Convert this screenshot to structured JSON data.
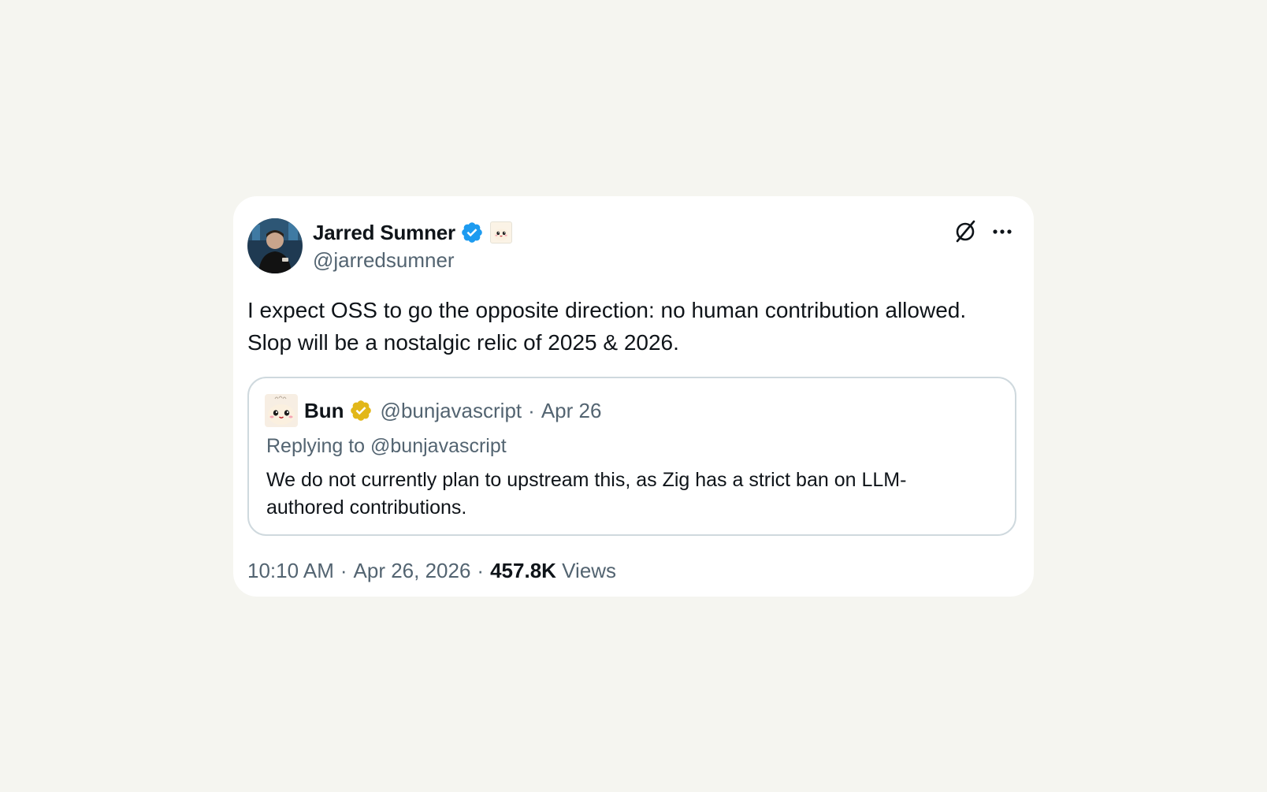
{
  "tweet": {
    "author": {
      "name": "Jarred Sumner",
      "handle": "@jarredsumner",
      "avatar_icon": "person-avatar",
      "verified_icon": "blue-verified-badge",
      "affiliate_icon": "bun-mascot-badge"
    },
    "header_icons": [
      "x-logo-icon",
      "more-options-icon"
    ],
    "text": "I expect OSS to go the opposite direction: no human contribution allowed.\nSlop will be a nostalgic relic of 2025 & 2026.",
    "quote": {
      "name": "Bun",
      "handle": "@bunjavascript",
      "separator": "·",
      "date": "Apr 26",
      "avatar_icon": "bun-mascot-avatar",
      "verified_icon": "gold-verified-badge",
      "replying_to": "Replying to @bunjavascript",
      "text": "We do not currently plan to upstream this, as Zig has a strict ban on LLM-\nauthored contributions."
    },
    "footer": {
      "time": "10:10 AM",
      "separator": "·",
      "date": "Apr 26, 2026",
      "views_count": "457.8K",
      "views_label": "Views"
    }
  },
  "colors": {
    "page_background": "#f5f5f0",
    "card_background": "#ffffff",
    "primary_text": "#0f1419",
    "secondary_text": "#536471",
    "verified_blue": "#1d9bf0",
    "verified_gold": "#e2b719",
    "border": "#cfd9de"
  }
}
